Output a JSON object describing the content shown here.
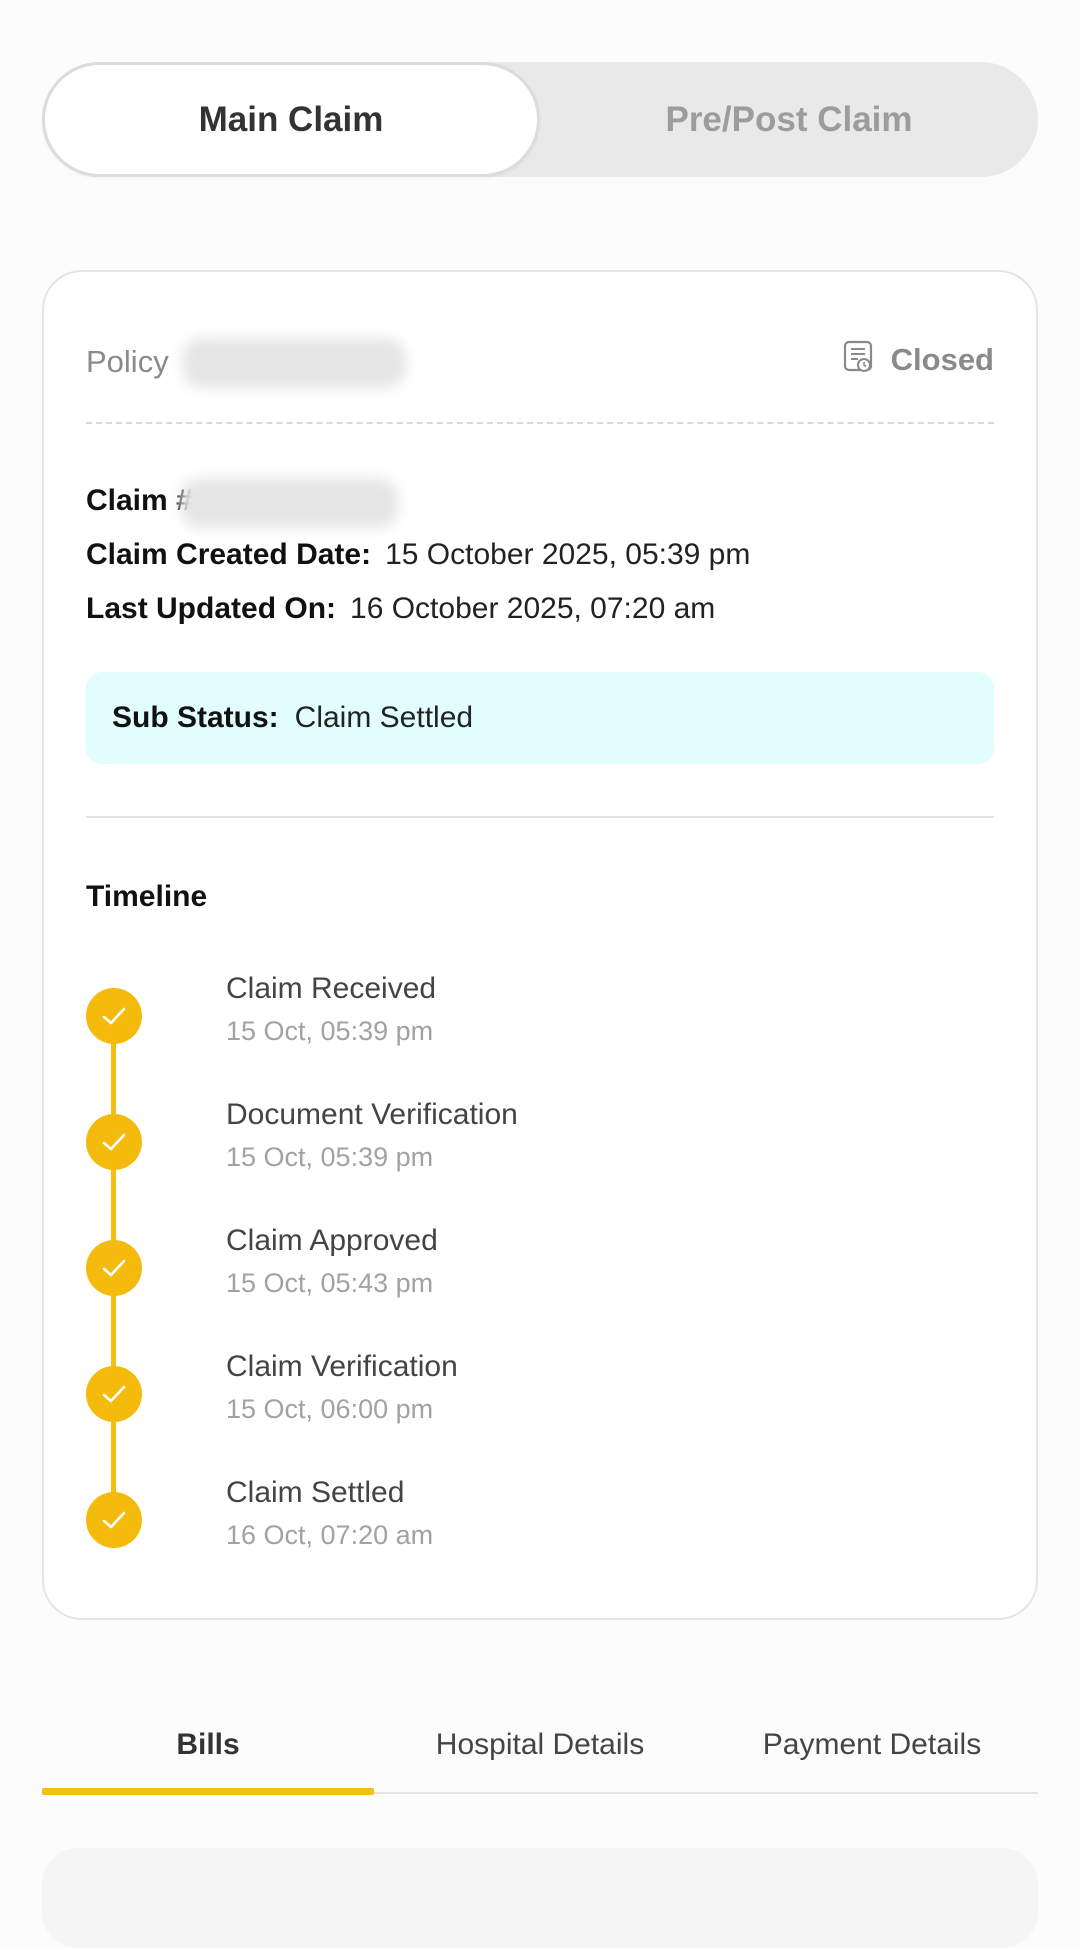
{
  "segmented": {
    "main_label": "Main Claim",
    "prepost_label": "Pre/Post Claim"
  },
  "card": {
    "policy_label": "Policy",
    "status_label": "Closed",
    "claim_label": "Claim #",
    "created_label": "Claim Created Date:",
    "created_value": "15 October 2025, 05:39 pm",
    "updated_label": "Last Updated On:",
    "updated_value": "16 October 2025, 07:20 am",
    "substatus_label": "Sub Status:",
    "substatus_value": "Claim Settled",
    "timeline_title": "Timeline",
    "timeline": [
      {
        "name": "Claim Received",
        "time": "15 Oct, 05:39 pm"
      },
      {
        "name": "Document Verification",
        "time": "15 Oct, 05:39 pm"
      },
      {
        "name": "Claim Approved",
        "time": "15 Oct, 05:43 pm"
      },
      {
        "name": "Claim Verification",
        "time": "15 Oct, 06:00 pm"
      },
      {
        "name": "Claim Settled",
        "time": "16 Oct, 07:20 am"
      }
    ]
  },
  "tabs": {
    "bills": "Bills",
    "hospital": "Hospital Details",
    "payment": "Payment Details"
  },
  "colors": {
    "accent": "#f4be12",
    "substatus_bg": "#e2fdfd"
  },
  "icons": {
    "status": "document-clock-icon",
    "check": "check-icon"
  }
}
